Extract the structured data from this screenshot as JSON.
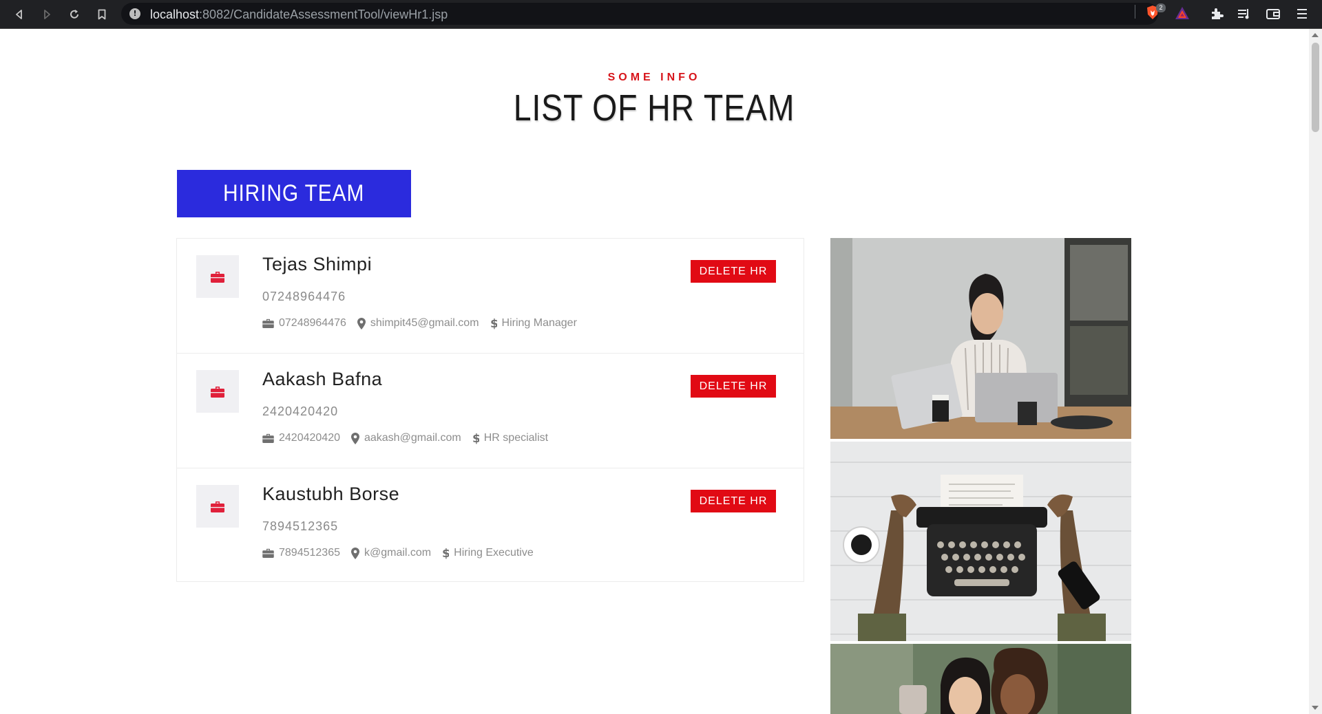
{
  "browser": {
    "url_host": "localhost",
    "url_path": ":8082/CandidateAssessmentTool/viewHr1.jsp",
    "shield_badge": "2"
  },
  "header": {
    "subheading": "SOME INFO",
    "title": "LIST OF HR TEAM"
  },
  "hiring_team_button": "HIRING TEAM",
  "delete_label": "DELETE HR",
  "hr_members": [
    {
      "name": "Tejas Shimpi",
      "phone": "07248964476",
      "contact": "07248964476",
      "email": "shimpit45@gmail.com",
      "role": "Hiring Manager"
    },
    {
      "name": "Aakash Bafna",
      "phone": "2420420420",
      "contact": "2420420420",
      "email": "aakash@gmail.com",
      "role": "HR specialist"
    },
    {
      "name": "Kaustubh Borse",
      "phone": "7894512365",
      "contact": "7894512365",
      "email": "k@gmail.com",
      "role": "Hiring Executive"
    }
  ],
  "icons": [
    "back-icon",
    "forward-icon",
    "reload-icon",
    "bookmark-icon",
    "site-info-icon",
    "brave-shield-icon",
    "rewards-icon",
    "extensions-icon",
    "media-icon",
    "wallet-icon",
    "menu-icon",
    "briefcase-icon",
    "map-marker-icon",
    "dollar-icon"
  ],
  "colors": {
    "accent_red": "#e10a14",
    "button_blue": "#2b2bdd",
    "subheading_red": "#d7141a"
  }
}
